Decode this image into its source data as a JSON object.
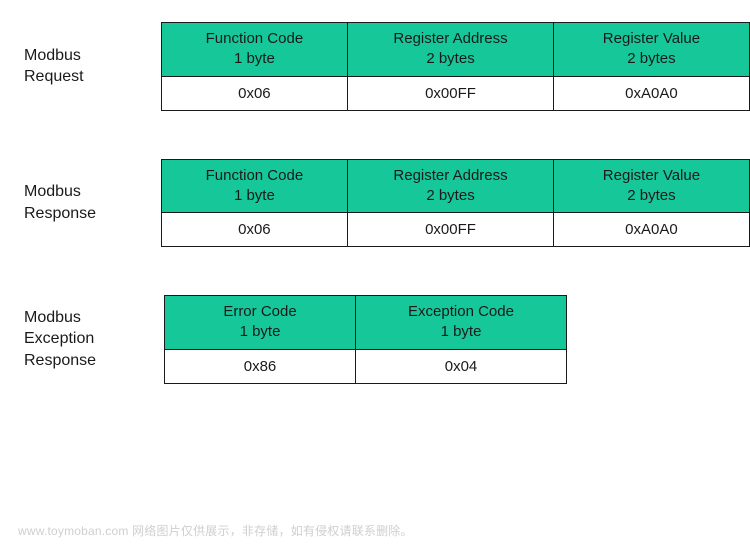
{
  "accent_color": "#16c79a",
  "sections": [
    {
      "label": "Modbus\nRequest",
      "cols": [
        {
          "name": "Function Code",
          "size": "1 byte",
          "value": "0x06"
        },
        {
          "name": "Register Address",
          "size": "2 bytes",
          "value": "0x00FF"
        },
        {
          "name": "Register Value",
          "size": "2 bytes",
          "value": "0xA0A0"
        }
      ]
    },
    {
      "label": "Modbus\nResponse",
      "cols": [
        {
          "name": "Function Code",
          "size": "1 byte",
          "value": "0x06"
        },
        {
          "name": "Register Address",
          "size": "2 bytes",
          "value": "0x00FF"
        },
        {
          "name": "Register Value",
          "size": "2 bytes",
          "value": "0xA0A0"
        }
      ]
    },
    {
      "label": "Modbus\nException\nResponse",
      "cols": [
        {
          "name": "Error Code",
          "size": "1 byte",
          "value": "0x86"
        },
        {
          "name": "Exception Code",
          "size": "1 byte",
          "value": "0x04"
        }
      ]
    }
  ],
  "watermark": "www.toymoban.com 网络图片仅供展示，非存储，如有侵权请联系删除。"
}
